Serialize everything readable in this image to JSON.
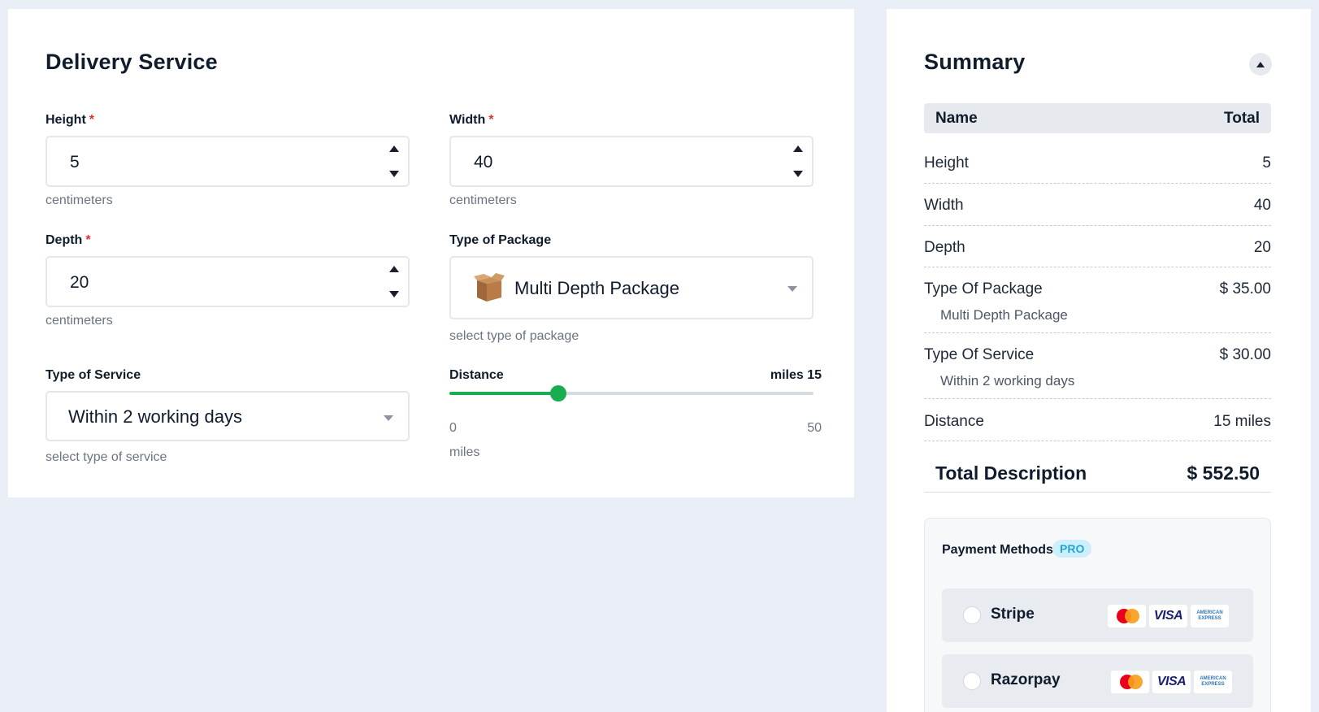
{
  "delivery": {
    "title": "Delivery Service",
    "height": {
      "label": "Height",
      "required": "*",
      "value": "5",
      "helper": "centimeters"
    },
    "width": {
      "label": "Width",
      "required": "*",
      "value": "40",
      "helper": "centimeters"
    },
    "depth": {
      "label": "Depth",
      "required": "*",
      "value": "20",
      "helper": "centimeters"
    },
    "package": {
      "label": "Type of Package",
      "value": "Multi Depth Package",
      "helper": "select type of package",
      "icon": "box-icon"
    },
    "service": {
      "label": "Type of Service",
      "value": "Within 2 working days",
      "helper": "select type of service"
    },
    "distance": {
      "label": "Distance",
      "value_text": "miles 15",
      "value": 15,
      "min": "0",
      "max": "50",
      "min_num": 0,
      "max_num": 50,
      "unit": "miles",
      "accent": "#1aad4f"
    }
  },
  "summary": {
    "title": "Summary",
    "header": {
      "name": "Name",
      "total": "Total"
    },
    "rows": [
      {
        "name": "Height",
        "value": "5"
      },
      {
        "name": "Width",
        "value": "40"
      },
      {
        "name": "Depth",
        "value": "20"
      },
      {
        "name": "Type Of Package",
        "value": "$ 35.00",
        "sub": "Multi Depth Package"
      },
      {
        "name": "Type Of Service",
        "value": "$ 30.00",
        "sub": "Within 2 working days"
      },
      {
        "name": "Distance",
        "value": "15 miles"
      }
    ],
    "total": {
      "label": "Total Description",
      "value": "$ 552.50"
    },
    "payment": {
      "title": "Payment Methods",
      "badge": "PRO",
      "options": [
        {
          "name": "Stripe",
          "cards": [
            "mastercard",
            "visa",
            "american-express"
          ]
        },
        {
          "name": "Razorpay",
          "cards": [
            "mastercard",
            "visa",
            "american-express"
          ]
        }
      ],
      "visa_text": "VISA",
      "amex_text": "AMERICAN EXPRESS"
    }
  }
}
